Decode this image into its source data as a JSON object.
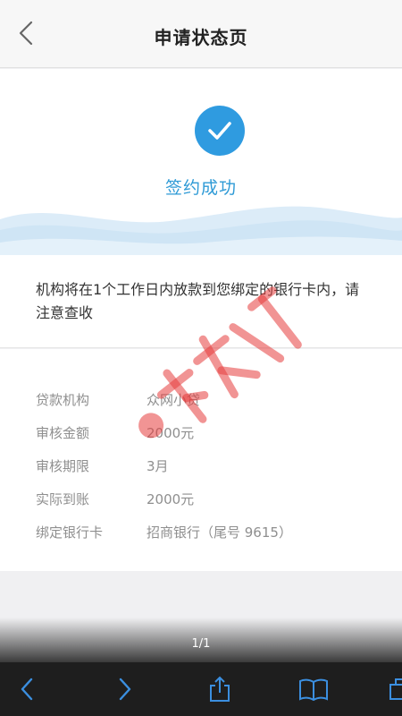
{
  "nav": {
    "title": "申请状态页",
    "back_icon": "chevron-left-icon"
  },
  "hero": {
    "status": "签约成功",
    "icon": "check-circle-icon",
    "accent": "#2f9be0"
  },
  "notice": {
    "text": "机构将在1个工作日内放款到您绑定的银行卡内，请注意查收"
  },
  "details": [
    {
      "label": "贷款机构",
      "value": "众网小贷"
    },
    {
      "label": "审核金额",
      "value": "2000元"
    },
    {
      "label": "审核期限",
      "value": "3月"
    },
    {
      "label": "实际到账",
      "value": "2000元"
    },
    {
      "label": "绑定银行卡",
      "value": "招商银行（尾号 9615）"
    }
  ],
  "pager": {
    "text": "1/1"
  },
  "watermark": {
    "text": "卡农社区"
  },
  "toolbar": {
    "icons": [
      "back-icon",
      "forward-icon",
      "share-icon",
      "bookmarks-icon",
      "tabs-icon"
    ]
  }
}
